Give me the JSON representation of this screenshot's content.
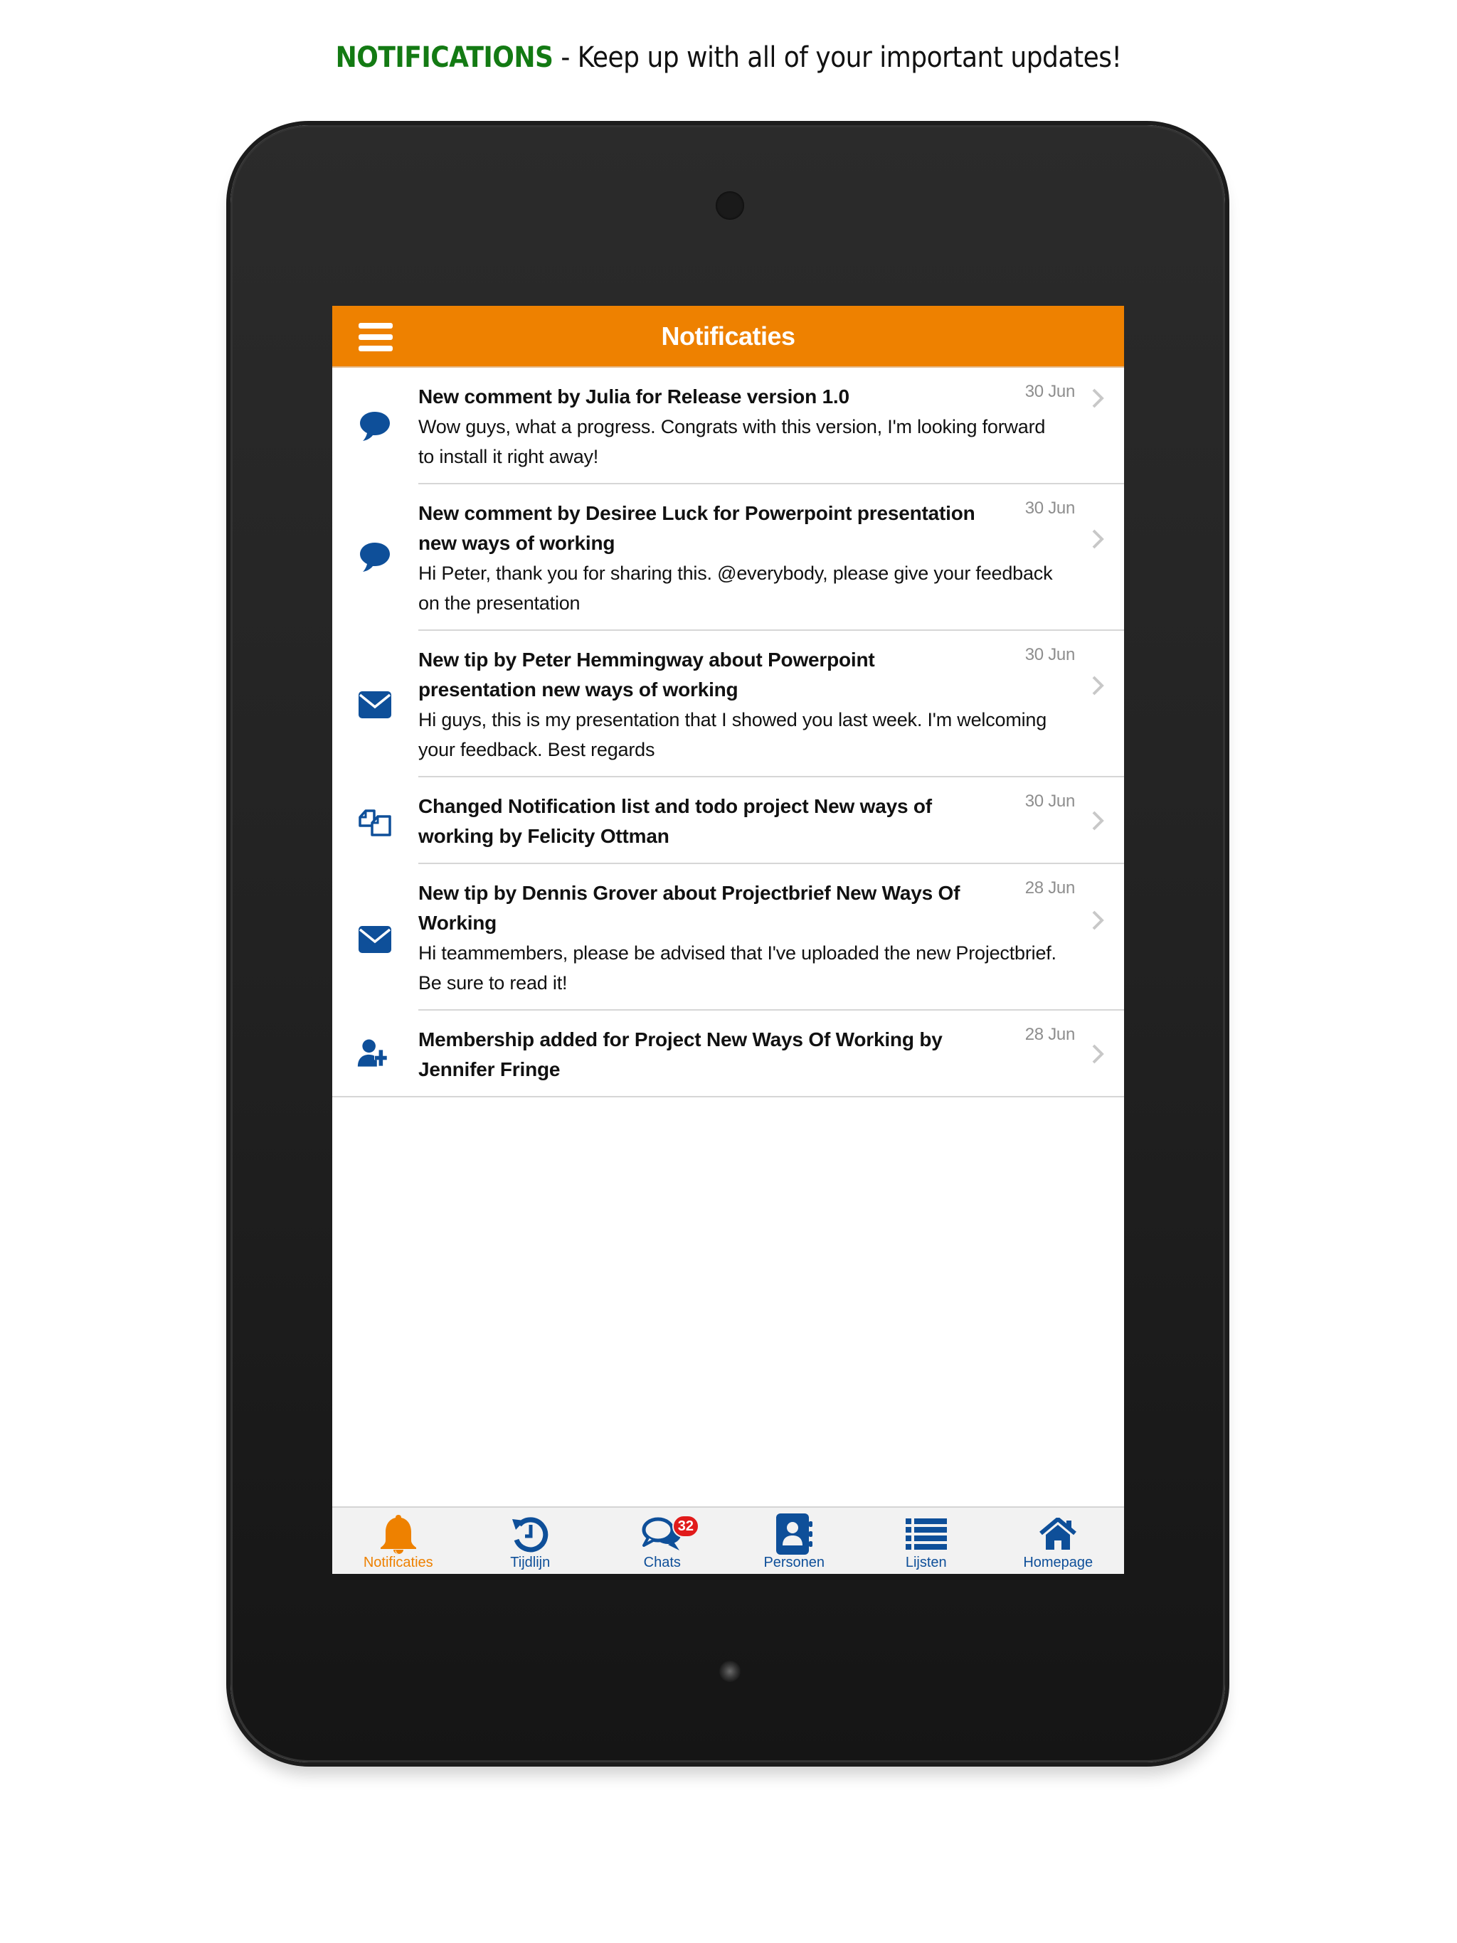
{
  "promo": {
    "accent": "NOTIFICATIONS",
    "text": " - Keep up with all of your important updates!"
  },
  "colors": {
    "brand_orange": "#ee8100",
    "icon_blue": "#0e4f99",
    "badge_red": "#e11b1b",
    "promo_green": "#137a13"
  },
  "appbar": {
    "menu_icon": "hamburger-menu-icon",
    "title": "Notificaties"
  },
  "notifications": [
    {
      "icon": "speech-bubble-icon",
      "title": "New comment by Julia for Release version 1.0",
      "body": "Wow guys, what a progress. Congrats with this version, I'm looking forward to install it right away!",
      "date": "30 Jun"
    },
    {
      "icon": "speech-bubble-icon",
      "title": "New comment by Desiree Luck for Powerpoint presentation new ways of working",
      "body": "Hi Peter, thank you for sharing this. @everybody, please give your feedback on the presentation",
      "date": "30 Jun"
    },
    {
      "icon": "envelope-icon",
      "title": "New tip by Peter Hemmingway about Powerpoint presentation new ways of working",
      "body": "Hi guys, this is my presentation that I showed you last week. I'm welcoming your feedback. Best regards",
      "date": "30 Jun"
    },
    {
      "icon": "copy-documents-icon",
      "title": "Changed Notification list and todo project New ways of working by Felicity Ottman",
      "body": "",
      "date": "30 Jun"
    },
    {
      "icon": "envelope-icon",
      "title": "New tip by Dennis Grover about Projectbrief New Ways Of Working",
      "body": "Hi teammembers, please be advised that I've uploaded the new Projectbrief. Be sure to read it!",
      "date": "28 Jun"
    },
    {
      "icon": "user-plus-icon",
      "title": "Membership added for Project New Ways Of Working by Jennifer Fringe",
      "body": "",
      "date": "28 Jun"
    }
  ],
  "tabbar": {
    "active": "Notificaties",
    "tabs": [
      {
        "label": "Notificaties",
        "icon": "bell-icon"
      },
      {
        "label": "Tijdlijn",
        "icon": "history-icon"
      },
      {
        "label": "Chats",
        "icon": "chats-icon",
        "badge": "32"
      },
      {
        "label": "Personen",
        "icon": "address-book-icon"
      },
      {
        "label": "Lijsten",
        "icon": "list-icon"
      },
      {
        "label": "Homepage",
        "icon": "home-icon"
      }
    ]
  }
}
